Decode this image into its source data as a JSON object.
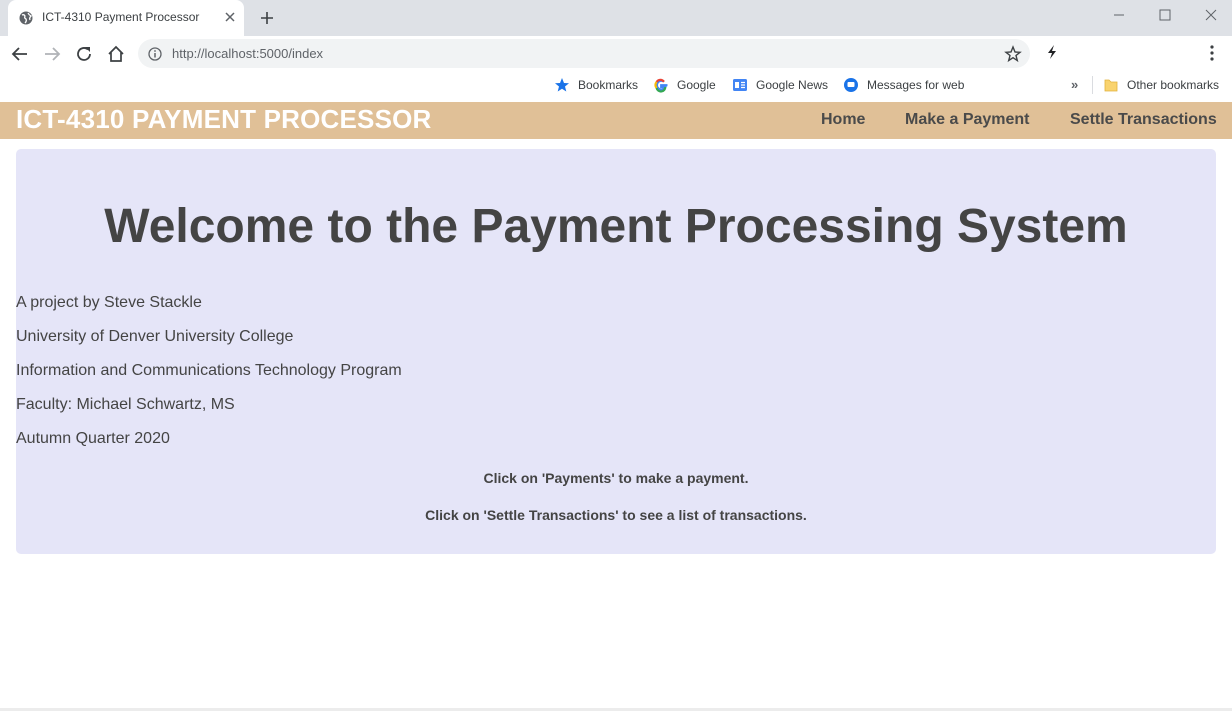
{
  "browser": {
    "tab_title": "ICT-4310 Payment Processor",
    "url": "http://localhost:5000/index",
    "bookmarks": [
      {
        "label": "Bookmarks",
        "icon": "star-icon"
      },
      {
        "label": "Google",
        "icon": "google-icon"
      },
      {
        "label": "Google News",
        "icon": "google-news-icon"
      },
      {
        "label": "Messages for web",
        "icon": "messages-icon"
      }
    ],
    "overflow": "»",
    "other_bookmarks": "Other bookmarks"
  },
  "header": {
    "brand": "ICT-4310 PAYMENT PROCESSOR",
    "nav": [
      "Home",
      "Make a Payment",
      "Settle Transactions"
    ],
    "bg_color": "#e0c097"
  },
  "main": {
    "title": "Welcome to the Payment Processing System",
    "lines": [
      "A project by Steve Stackle",
      "University of Denver University College",
      "Information and Communications Technology Program",
      "Faculty: Michael Schwartz, MS",
      "Autumn Quarter 2020"
    ],
    "hints": [
      "Click on 'Payments' to make a payment.",
      "Click on 'Settle Transactions' to see a list of transactions."
    ],
    "bg_color": "#e5e5f8"
  }
}
